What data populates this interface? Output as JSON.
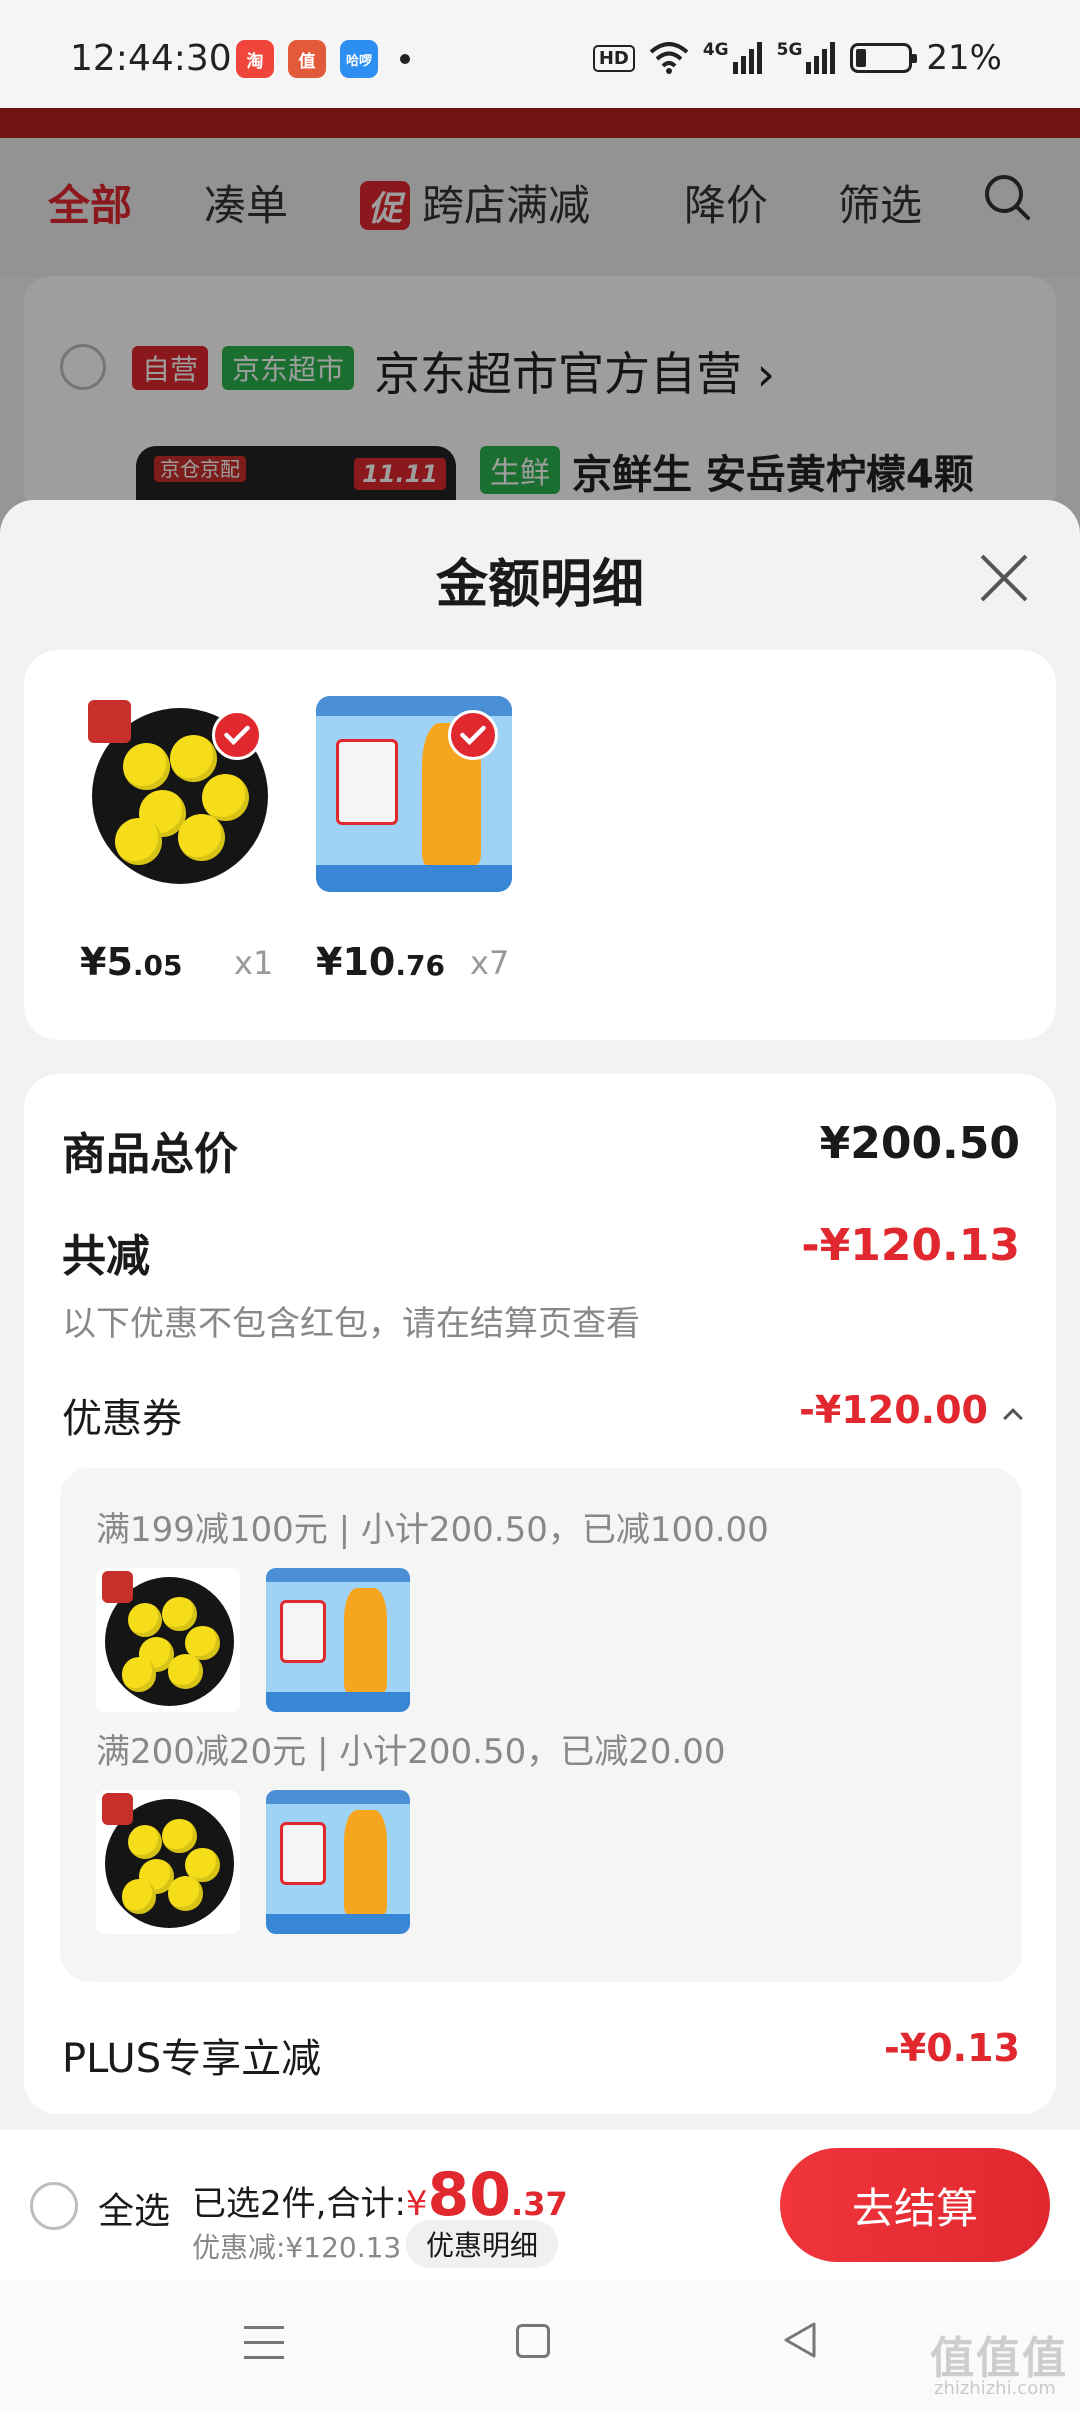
{
  "status_bar": {
    "time": "12:44:30",
    "app_icons": [
      {
        "name": "taobao-app-icon",
        "color": "#f0453a",
        "label": "淘"
      },
      {
        "name": "zhi-app-icon",
        "color": "#e35a3b",
        "label": "值"
      },
      {
        "name": "hello-app-icon",
        "color": "#2b8ef0",
        "label": "哈啰"
      }
    ],
    "hd": "HD",
    "net_4g": "4G",
    "net_5g": "5G",
    "battery": "21%"
  },
  "cart": {
    "tabs": {
      "all": "全部",
      "combine": "凑单",
      "promo_tag": "促",
      "cross_store": "跨店满减",
      "price_drop": "降价",
      "filter": "筛选"
    },
    "store": {
      "tag_self": "自营",
      "tag_market": "京东超市",
      "name": "京东超市官方自营"
    },
    "product": {
      "tag_fresh": "生鲜",
      "title": "京鲜生 安岳黄柠檬4颗",
      "thumb_tag": "京仓京配",
      "thumb_event": "11.11"
    }
  },
  "sheet": {
    "title": "金额明细",
    "items": [
      {
        "price_int": "¥5",
        "price_dec": ".05",
        "qty": "x1",
        "thumb": "lemon"
      },
      {
        "price_int": "¥10",
        "price_dec": ".76",
        "qty": "x7",
        "thumb": "juice"
      }
    ],
    "total_label": "商品总价",
    "total_value": "¥200.50",
    "reduce_label": "共减",
    "reduce_value": "-¥120.13",
    "reduce_note": "以下优惠不包含红包，请在结算页查看",
    "coupon_label": "优惠券",
    "coupon_value": "-¥120.00",
    "coupon_lines": [
      "满199减100元 | 小计200.50，已减100.00",
      "满200减20元 | 小计200.50，已减20.00"
    ],
    "plus_label": "PLUS专享立减",
    "plus_value": "-¥0.13"
  },
  "bottom_bar": {
    "select_all": "全选",
    "selected_text": "已选2件,合计:",
    "currency": "¥",
    "total_int": "80",
    "total_dec": ".37",
    "discount_text": "优惠减:¥120.13",
    "detail_button": "优惠明细",
    "checkout_button": "去结算"
  },
  "watermark": {
    "main": "值值值",
    "sub": "zhizhizhi.com"
  },
  "colors": {
    "accent": "#e0282e",
    "market_green": "#2bb24c",
    "strip": "#b51f1f"
  }
}
